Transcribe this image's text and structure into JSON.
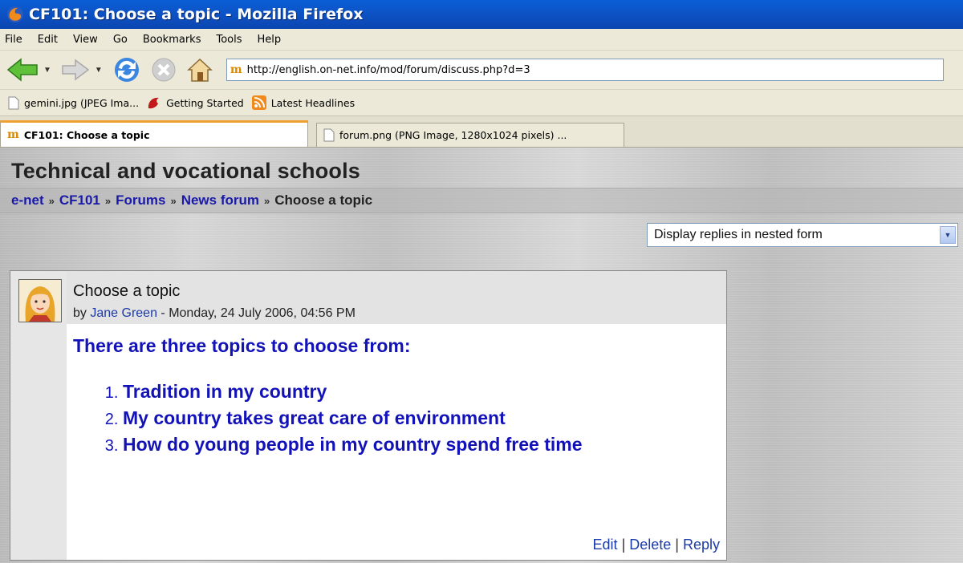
{
  "window": {
    "title": "CF101: Choose a topic - Mozilla Firefox"
  },
  "menu": [
    "File",
    "Edit",
    "View",
    "Go",
    "Bookmarks",
    "Tools",
    "Help"
  ],
  "url": "http://english.on-net.info/mod/forum/discuss.php?d=3",
  "bookmarks": [
    "gemini.jpg (JPEG Ima...",
    "Getting Started",
    "Latest Headlines"
  ],
  "tabs": [
    "CF101: Choose a topic",
    "forum.png (PNG Image, 1280x1024 pixels) ..."
  ],
  "page": {
    "site_title": "Technical and vocational schools",
    "breadcrumb": [
      "e-net",
      "CF101",
      "Forums",
      "News forum",
      "Choose a topic"
    ],
    "breadcrumb_separator": "»",
    "display_mode": "Display replies in nested form"
  },
  "post": {
    "subject": "Choose a topic",
    "by_prefix": "by",
    "author": "Jane Green",
    "date": " - Monday, 24 July 2006, 04:56 PM",
    "intro": "There are three topics to choose from:",
    "topics": [
      "Tradition in my country",
      "My country takes great care of environment",
      "How do young people in my country spend free time"
    ],
    "actions": [
      "Edit",
      "Delete",
      "Reply"
    ],
    "action_separator": " | "
  },
  "colors": {
    "link": "#1a1aaa",
    "titlebar": "#0a5fd6",
    "tab_highlight": "#f0a030"
  },
  "icons": [
    "firefox-icon",
    "back-arrow-icon",
    "forward-arrow-icon",
    "reload-icon",
    "stop-icon",
    "home-icon",
    "moodle-icon",
    "page-icon",
    "getting-started-icon",
    "rss-icon",
    "dropdown-arrow-icon"
  ]
}
